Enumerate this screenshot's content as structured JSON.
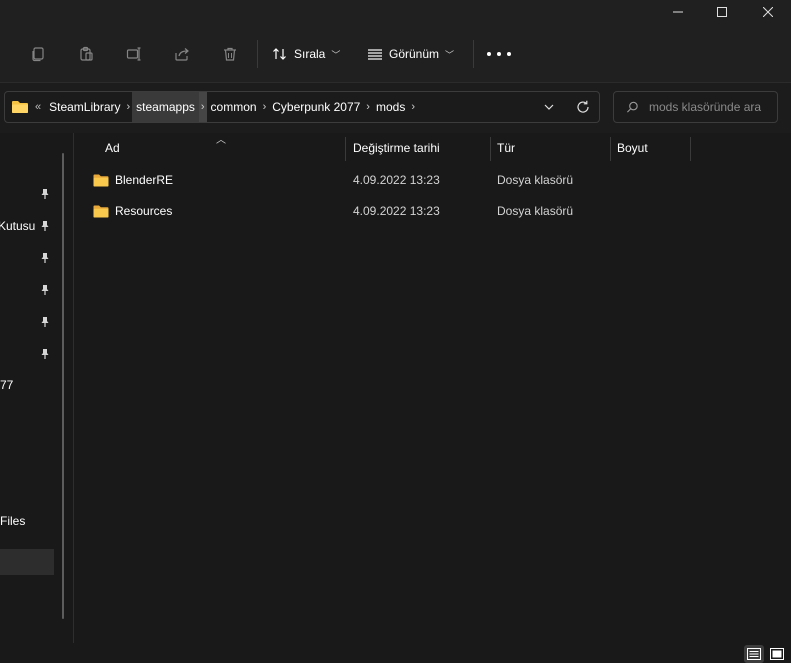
{
  "window": {
    "controls": [
      "minimize-icon",
      "maximize-icon",
      "close-icon"
    ]
  },
  "toolbar": {
    "disabled_icons": [
      "copy-icon",
      "paste-icon",
      "rename-icon",
      "share-icon",
      "delete-icon"
    ],
    "sort_label": "Sırala",
    "view_label": "Görünüm",
    "more_icon": "more-icon"
  },
  "address": {
    "folder_icon": "folder-icon",
    "overflow": "«",
    "crumbs": [
      "SteamLibrary",
      "steamapps",
      "common",
      "Cyberpunk 2077",
      "mods"
    ],
    "highlighted_crumb": "steamapps"
  },
  "search": {
    "placeholder": "mods klasöründe ara"
  },
  "nav": {
    "items": [
      "",
      "Kutusu",
      "",
      "",
      "",
      "",
      "77",
      "Files"
    ]
  },
  "columns": {
    "name": "Ad",
    "date": "Değiştirme tarihi",
    "type": "Tür",
    "size": "Boyut"
  },
  "files": [
    {
      "name": "BlenderRE",
      "date": "4.09.2022 13:23",
      "type": "Dosya klasörü",
      "size": ""
    },
    {
      "name": "Resources",
      "date": "4.09.2022 13:23",
      "type": "Dosya klasörü",
      "size": ""
    }
  ],
  "colors": {
    "background": "#191919",
    "chrome": "#202020",
    "folder": "#f5c242",
    "text": "#ffffff"
  }
}
